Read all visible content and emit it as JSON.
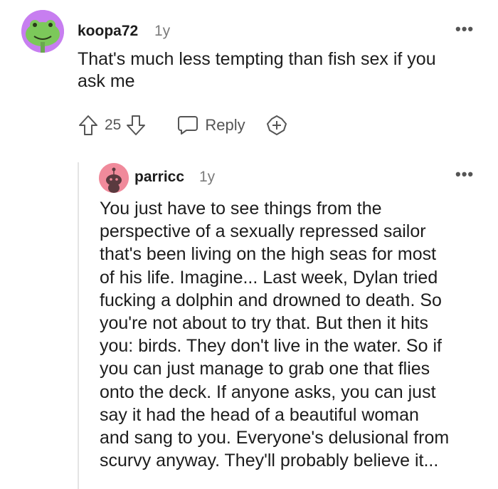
{
  "comments": [
    {
      "username": "koopa72",
      "age": "1y",
      "body_lines": [
        "That's much less tempting than fish sex if you",
        "ask me"
      ],
      "votes": "25",
      "reply_label": "Reply",
      "avatar_icon": "frog-avatar-icon"
    },
    {
      "username": "parricc",
      "age": "1y",
      "body_lines": [
        "You just have to see things from the",
        "perspective of a sexually repressed sailor",
        "that's been living on the high seas for most",
        "of his life. Imagine... Last week, Dylan tried",
        "fucking a dolphin and drowned to death. So",
        "you're not about to try that. But then it hits",
        "you: birds. They don't live in the water. So if",
        "you can just manage to grab one that flies",
        "onto the deck. If anyone asks, you can just",
        "say it had the head of a beautiful woman",
        "and sang to you. Everyone's delusional from",
        "scurvy anyway. They'll probably believe it..."
      ],
      "avatar_icon": "snoo-avatar-icon"
    }
  ],
  "more_glyph": "•••",
  "colors": {
    "text": "#1c1c1c",
    "muted": "#7c7c7c",
    "icon": "#555555",
    "avatar1_bg": "#c77ef0",
    "avatar1_frog": "#7cc85a",
    "avatar2_bg": "#f08a9b",
    "thread_line": "#e4e4e4"
  }
}
